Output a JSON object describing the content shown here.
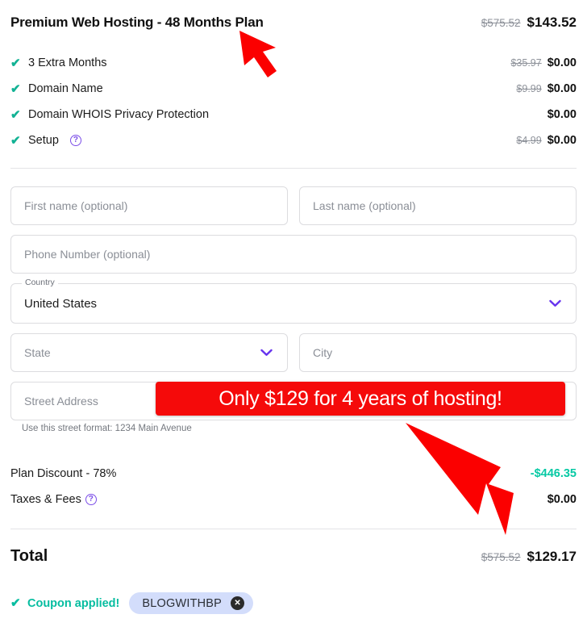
{
  "plan": {
    "title": "Premium Web Hosting - 48 Months Plan",
    "price_old": "$575.52",
    "price_new": "$143.52"
  },
  "features": [
    {
      "check": "✔",
      "label": "3 Extra Months",
      "price_old": "$35.97",
      "price_new": "$0.00",
      "has_help": false
    },
    {
      "check": "✔",
      "label": "Domain Name",
      "price_old": "$9.99",
      "price_new": "$0.00",
      "has_help": false
    },
    {
      "check": "✔",
      "label": "Domain WHOIS Privacy Protection",
      "price_old": "",
      "price_new": "$0.00",
      "has_help": false
    },
    {
      "check": "✔",
      "label": "Setup",
      "price_old": "$4.99",
      "price_new": "$0.00",
      "has_help": true,
      "help_glyph": "?"
    }
  ],
  "form": {
    "first_name_placeholder": "First name (optional)",
    "last_name_placeholder": "Last name (optional)",
    "phone_placeholder": "Phone Number (optional)",
    "country_label": "Country",
    "country_value": "United States",
    "state_placeholder": "State",
    "city_placeholder": "City",
    "street_placeholder": "Street Address",
    "street_helper": "Use this street format: 1234 Main Avenue",
    "chevron_glyph": "❯"
  },
  "summary": [
    {
      "label": "Plan Discount - 78%",
      "value": "-$446.35",
      "style": "discount",
      "has_help": false
    },
    {
      "label": "Taxes & Fees",
      "value": "$0.00",
      "style": "normal",
      "has_help": true,
      "help_glyph": "?"
    }
  ],
  "total": {
    "label": "Total",
    "price_old": "$575.52",
    "price_new": "$129.17"
  },
  "coupon": {
    "check": "✔",
    "applied_text": "Coupon applied!",
    "code": "BLOGWITHBP",
    "remove_glyph": "✕"
  },
  "annotations": {
    "banner_text": "Only $129 for 4 years of hosting!",
    "banner_color": "#f50a0a",
    "arrow_color": "#fb0000"
  },
  "colors": {
    "check_green": "#12b294",
    "discount_green": "#06c9a4",
    "coupon_green": "#06bda0",
    "purple_accent": "#6633ee",
    "chip_background": "#d3ddfb",
    "strikethrough_gray": "#8e929a"
  }
}
